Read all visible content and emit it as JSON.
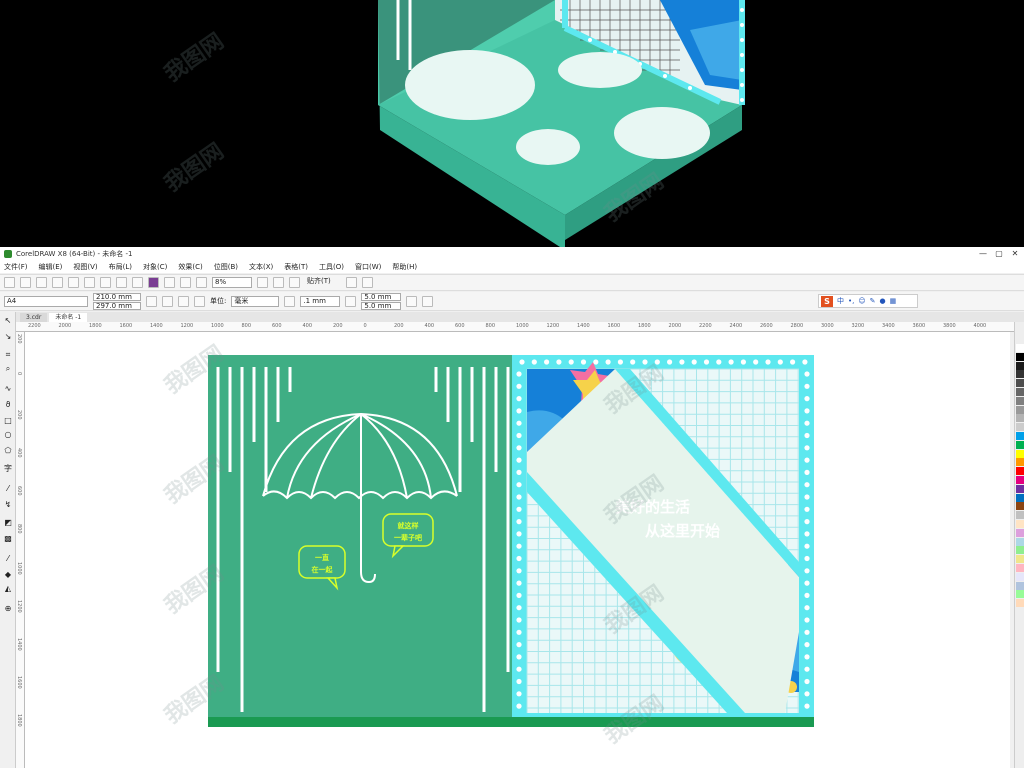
{
  "app": {
    "title": "CorelDRAW X8 (64-Bit) - 未命名 -1",
    "window_buttons": [
      "—",
      "▢",
      "✕"
    ]
  },
  "menu": [
    "文件(F)",
    "编辑(E)",
    "视图(V)",
    "布局(L)",
    "对象(C)",
    "效果(C)",
    "位图(B)",
    "文本(X)",
    "表格(T)",
    "工具(O)",
    "窗口(W)",
    "帮助(H)"
  ],
  "toolbar": {
    "zoom": "8%",
    "snap_label": "贴齐(T)",
    "page_size": "A4",
    "width": "210.0 mm",
    "height": "297.0 mm",
    "unit_label": "单位:",
    "unit": "毫米",
    "nudge": ".1 mm",
    "dup_x": "5.0 mm",
    "dup_y": "5.0 mm"
  },
  "ime": {
    "logo": "S",
    "lang": "中",
    "punct": "•,"
  },
  "tabs": [
    "3.cdr",
    "未命名 -1"
  ],
  "ruler": {
    "h_ticks": [
      "2200",
      "2000",
      "1800",
      "1600",
      "1400",
      "1200",
      "1000",
      "800",
      "600",
      "400",
      "200",
      "0",
      "200",
      "400",
      "600",
      "800",
      "1000",
      "1200",
      "1400",
      "1600",
      "1800",
      "2000",
      "2200",
      "2400",
      "2600",
      "2800",
      "3000",
      "3200",
      "3400",
      "3600",
      "3800",
      "4000"
    ],
    "v_ticks": [
      "200",
      "0",
      "200",
      "400",
      "600",
      "800",
      "1000",
      "1200",
      "1400",
      "1600",
      "1800"
    ]
  },
  "design": {
    "headline_1": "美好的生活",
    "headline_2": "从这里开始",
    "bubble_left_1": "一直",
    "bubble_left_2": "在一起",
    "bubble_right_1": "就这样",
    "bubble_right_2": "一辈子吧",
    "colors": {
      "panel_green": "#3fae84",
      "dark_green": "#1a9a52",
      "cyan_frame": "#5de8ef",
      "grid_bg": "#eaf8f8",
      "blue": "#1580d8",
      "yellow": "#f6d24a",
      "pink": "#f46fa2",
      "bubble_stroke": "#d8ff2a"
    }
  },
  "watermark": "我图网",
  "palette": [
    "#ffffff",
    "#000000",
    "#1a1a1a",
    "#333333",
    "#4d4d4d",
    "#666666",
    "#808080",
    "#999999",
    "#b3b3b3",
    "#cccccc",
    "#00a0e9",
    "#00b050",
    "#ffff00",
    "#ff9900",
    "#ff0000",
    "#e4007f",
    "#7030a0",
    "#0070c0",
    "#8b4513",
    "#c0c0c0",
    "#ffe4c4",
    "#dda0dd",
    "#add8e6",
    "#90ee90",
    "#f0e68c",
    "#ffb6c1",
    "#e6e6fa",
    "#b0c4de",
    "#98fb98",
    "#ffdab9"
  ]
}
